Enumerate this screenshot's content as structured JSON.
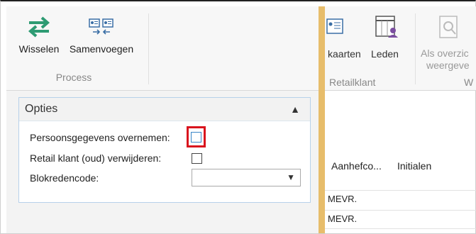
{
  "ribbon": {
    "wisselen_label": "Wisselen",
    "samenvoegen_label": "Samenvoegen",
    "group_label": "Process",
    "right": {
      "kaarten_label": "kaarten",
      "leden_label": "Leden",
      "overzicht_label_line1": "Als overzic",
      "overzicht_label_line2": "weergeve",
      "group_label": "Retailklant",
      "group_label_cut": "W"
    }
  },
  "options": {
    "title": "Opties",
    "persoonsgegevens_label": "Persoonsgegevens overnemen:",
    "persoonsgegevens_checked": false,
    "retail_label": "Retail klant (oud) verwijderen:",
    "retail_checked": false,
    "blokreden_label": "Blokredencode:",
    "blokreden_value": ""
  },
  "grid": {
    "columns": [
      "Aanhefco...",
      "Initialen"
    ],
    "rows": [
      {
        "aanhef": "MEVR."
      },
      {
        "aanhef": "MEVR."
      }
    ]
  },
  "colors": {
    "accent_gold": "#e7bd6b",
    "highlight_red": "#d9141e",
    "panel_border": "#b7d1ea",
    "wisselen_icon": "#2e9b73"
  }
}
